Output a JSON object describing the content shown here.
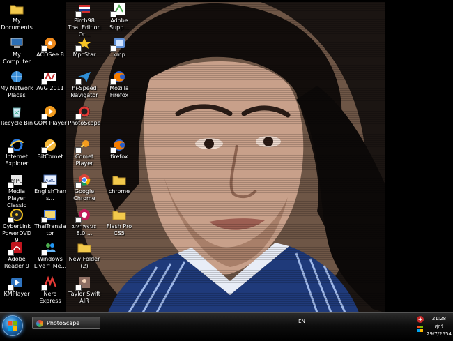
{
  "desktop": {
    "icons": [
      {
        "label": "My Documents",
        "icon": "folder-icon",
        "shortcut": false
      },
      {
        "label": "My Computer",
        "icon": "computer-icon",
        "shortcut": false
      },
      {
        "label": "My Network Places",
        "icon": "network-icon",
        "shortcut": false
      },
      {
        "label": "Recycle Bin",
        "icon": "recycle-bin-icon",
        "shortcut": false
      },
      {
        "label": "Internet Explorer",
        "icon": "internet-explorer-icon",
        "shortcut": true
      },
      {
        "label": "Media Player Classic",
        "icon": "media-player-icon",
        "shortcut": true
      },
      {
        "label": "CyberLink PowerDVD 9",
        "icon": "powerdvd-icon",
        "shortcut": true
      },
      {
        "label": "Adobe Reader 9",
        "icon": "adobe-reader-icon",
        "shortcut": true
      },
      {
        "label": "KMPlayer",
        "icon": "kmplayer-icon",
        "shortcut": true
      },
      {
        "label": "ACDSee 8",
        "icon": "acdsee-icon",
        "shortcut": true
      },
      {
        "label": "AVG 2011",
        "icon": "avg-icon",
        "shortcut": true
      },
      {
        "label": "GOM Player",
        "icon": "gom-player-icon",
        "shortcut": true
      },
      {
        "label": "BitComet",
        "icon": "bitcomet-icon",
        "shortcut": true
      },
      {
        "label": "EnglishTrans...",
        "icon": "dictionary-icon",
        "shortcut": true
      },
      {
        "label": "ThaiTranslator",
        "icon": "translator-icon",
        "shortcut": true
      },
      {
        "label": "Windows Live™ Me...",
        "icon": "messenger-icon",
        "shortcut": true
      },
      {
        "label": "Nero Express",
        "icon": "nero-icon",
        "shortcut": true
      },
      {
        "label": "Pirch98 Thai Edition Or...",
        "icon": "flag-icon",
        "shortcut": true
      },
      {
        "label": "MpcStar",
        "icon": "mpcstar-icon",
        "shortcut": true
      },
      {
        "label": "hi-Speed Navigator",
        "icon": "navigator-icon",
        "shortcut": true
      },
      {
        "label": "PhotoScape",
        "icon": "photoscape-icon",
        "shortcut": true
      },
      {
        "label": "Comet Player",
        "icon": "comet-player-icon",
        "shortcut": true
      },
      {
        "label": "Google Chrome",
        "icon": "chrome-icon",
        "shortcut": true
      },
      {
        "label": "มหาพจนะ 8.0 ...",
        "icon": "thai-dictionary-icon",
        "shortcut": true
      },
      {
        "label": "New Folder (2)",
        "icon": "folder-icon",
        "shortcut": false
      },
      {
        "label": "Taylor Swift AIR",
        "icon": "photo-icon",
        "shortcut": true
      },
      {
        "label": "Adobe Supp...",
        "icon": "adobe-support-icon",
        "shortcut": true
      },
      {
        "label": "kmp",
        "icon": "kmp-icon",
        "shortcut": true
      },
      {
        "label": "Mozilla Firefox",
        "icon": "firefox-icon",
        "shortcut": true
      },
      {
        "label": "firefox",
        "icon": "firefox-icon",
        "shortcut": true
      },
      {
        "label": "chrome",
        "icon": "folder-icon",
        "shortcut": false
      },
      {
        "label": "Flash Pro CS5",
        "icon": "folder-icon",
        "shortcut": false
      }
    ]
  },
  "taskbar": {
    "start_icon": "windows-logo-icon",
    "tasks": [
      {
        "label": "PhotoScape",
        "icon": "photoscape-icon"
      }
    ],
    "language": "EN",
    "clock": {
      "time": "21:28",
      "day": "ศุกร์",
      "date": "29/7/2554"
    }
  },
  "colors": {
    "taskbar": "#0d0d0d",
    "desktop_background": "#000000",
    "accent_start": "#1c6fb8"
  }
}
